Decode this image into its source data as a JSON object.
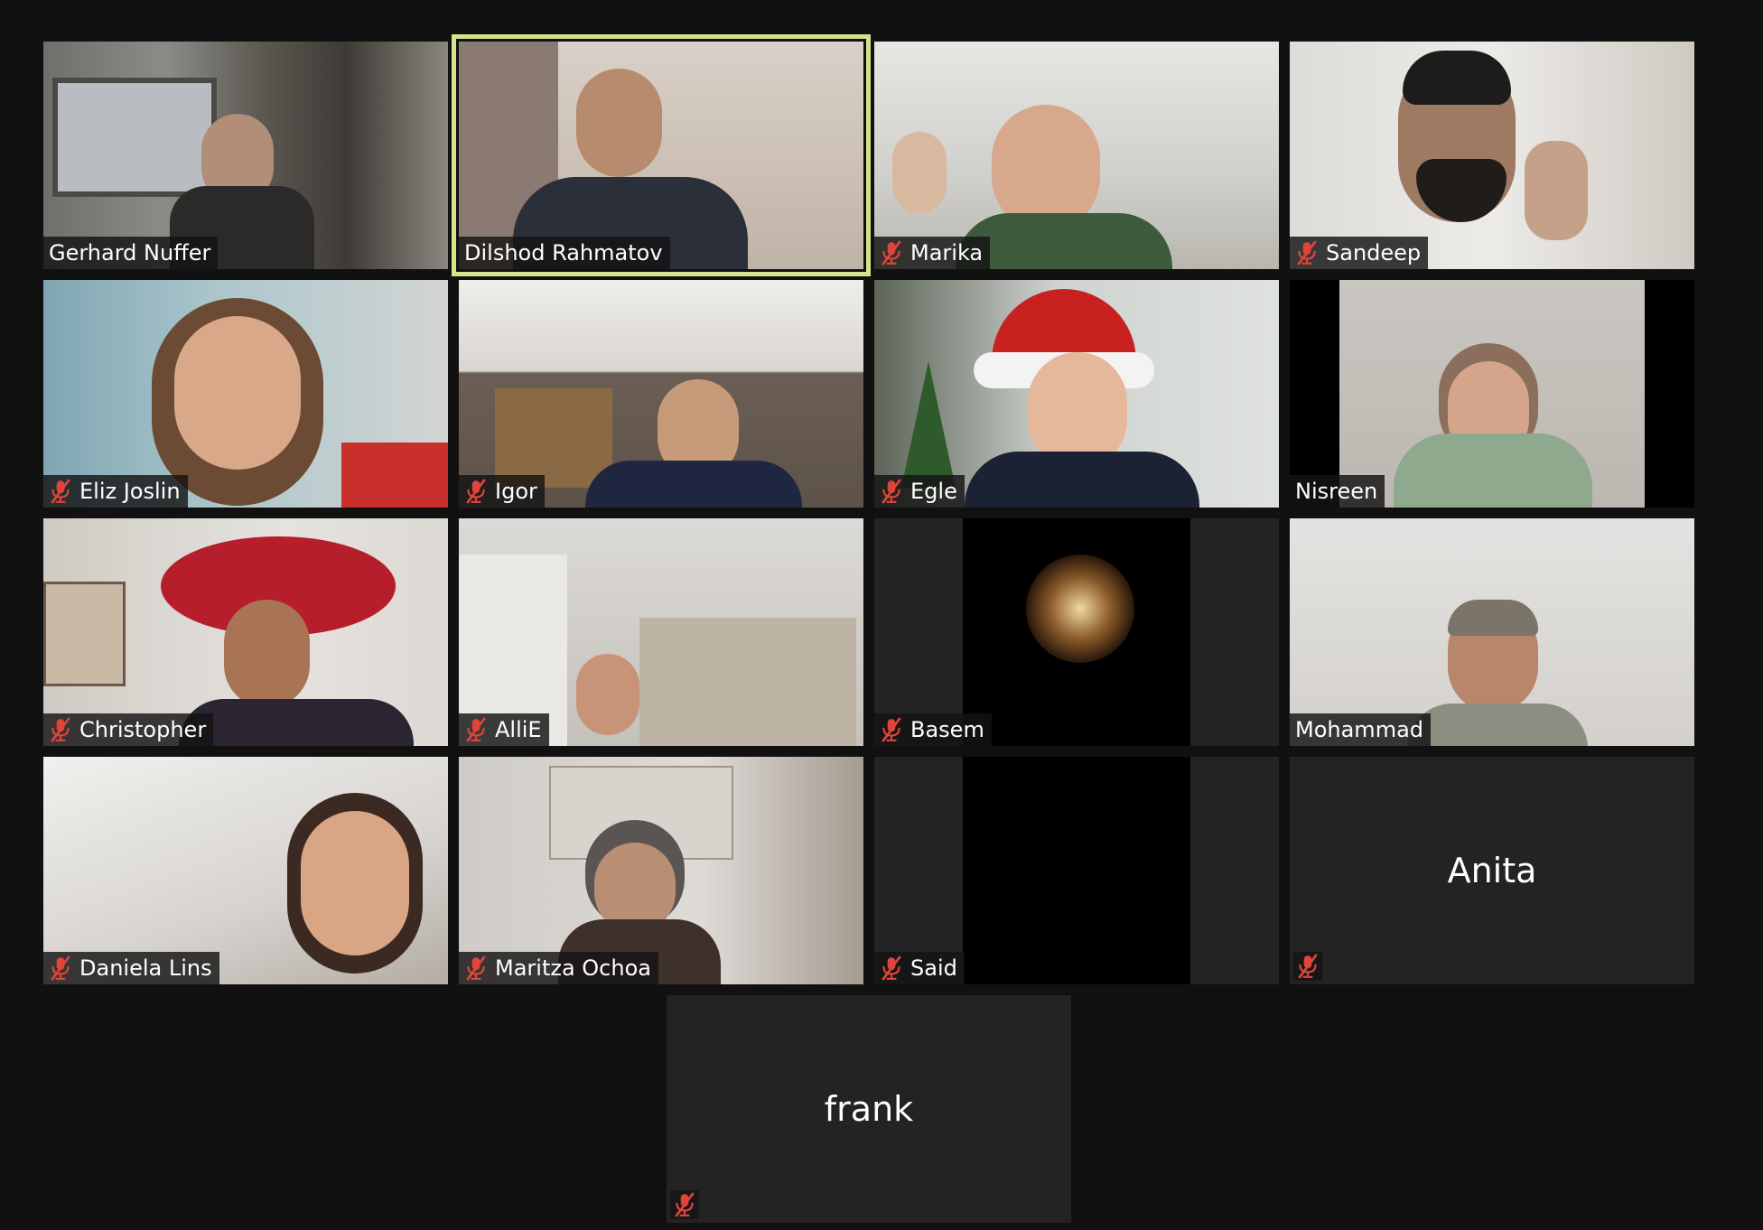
{
  "meeting": {
    "participants": [
      {
        "name": "Gerhard Nuffer",
        "muted": false,
        "speaking": false
      },
      {
        "name": "Dilshod Rahmatov",
        "muted": false,
        "speaking": true
      },
      {
        "name": "Marika",
        "muted": true,
        "speaking": false
      },
      {
        "name": "Sandeep",
        "muted": true,
        "speaking": false
      },
      {
        "name": "Eliz Joslin",
        "muted": true,
        "speaking": false
      },
      {
        "name": "Igor",
        "muted": true,
        "speaking": false
      },
      {
        "name": "Egle",
        "muted": true,
        "speaking": false
      },
      {
        "name": "Nisreen",
        "muted": false,
        "speaking": false
      },
      {
        "name": "Christopher",
        "muted": true,
        "speaking": false
      },
      {
        "name": "AlliE",
        "muted": true,
        "speaking": false
      },
      {
        "name": "Basem",
        "muted": true,
        "speaking": false
      },
      {
        "name": "Mohammad",
        "muted": false,
        "speaking": false
      },
      {
        "name": "Daniela Lins",
        "muted": true,
        "speaking": false
      },
      {
        "name": "Maritza Ochoa",
        "muted": true,
        "speaking": false
      },
      {
        "name": "Said",
        "muted": true,
        "speaking": false
      },
      {
        "name": "Anita",
        "muted": true,
        "speaking": false,
        "video_off": true
      },
      {
        "name": "frank",
        "muted": true,
        "speaking": false,
        "video_off": true
      }
    ]
  },
  "colors": {
    "background": "#111111",
    "tile_empty": "#232323",
    "speaking_border": "#d6e38a",
    "mute_icon": "#e0443a"
  }
}
